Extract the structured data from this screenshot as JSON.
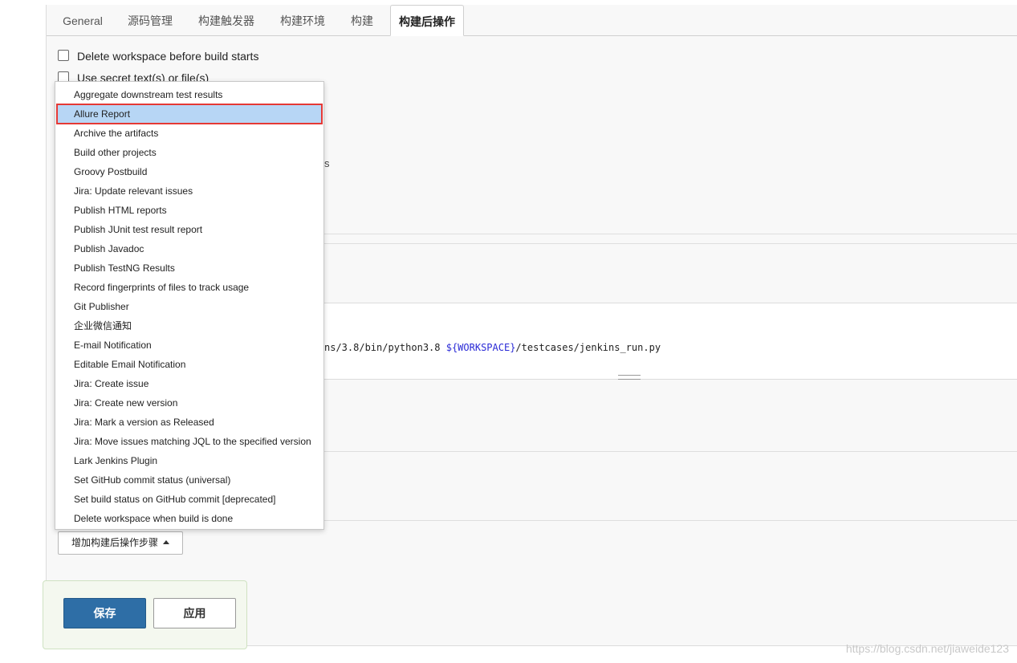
{
  "tabs": [
    {
      "label": "General",
      "active": false
    },
    {
      "label": "源码管理",
      "active": false
    },
    {
      "label": "构建触发器",
      "active": false
    },
    {
      "label": "构建环境",
      "active": false
    },
    {
      "label": "构建",
      "active": false
    },
    {
      "label": "构建后操作",
      "active": true
    }
  ],
  "build_env": {
    "options": [
      {
        "label": "Delete workspace before build starts",
        "checked": false
      },
      {
        "label": "Use secret text(s) or file(s)",
        "checked": false
      }
    ],
    "hidden_fragment": "s"
  },
  "build": {
    "command_prefix": "ns/3.8/bin/python3.8 ",
    "command_var": "${WORKSPACE}",
    "command_suffix": "/testcases/jenkins_run.py"
  },
  "post_build": {
    "menu_items": [
      {
        "label": "Aggregate downstream test results"
      },
      {
        "label": "Allure Report",
        "highlighted": true
      },
      {
        "label": "Archive the artifacts"
      },
      {
        "label": "Build other projects"
      },
      {
        "label": "Groovy Postbuild"
      },
      {
        "label": "Jira: Update relevant issues"
      },
      {
        "label": "Publish HTML reports"
      },
      {
        "label": "Publish JUnit test result report"
      },
      {
        "label": "Publish Javadoc"
      },
      {
        "label": "Publish TestNG Results"
      },
      {
        "label": "Record fingerprints of files to track usage"
      },
      {
        "label": "Git Publisher"
      },
      {
        "label": "企业微信通知"
      },
      {
        "label": "E-mail Notification"
      },
      {
        "label": "Editable Email Notification"
      },
      {
        "label": "Jira: Create issue"
      },
      {
        "label": "Jira: Create new version"
      },
      {
        "label": "Jira: Mark a version as Released"
      },
      {
        "label": "Jira: Move issues matching JQL to the specified version"
      },
      {
        "label": "Lark Jenkins Plugin"
      },
      {
        "label": "Set GitHub commit status (universal)"
      },
      {
        "label": "Set build status on GitHub commit [deprecated]"
      },
      {
        "label": "Delete workspace when build is done"
      }
    ],
    "add_step_label": "增加构建后操作步骤"
  },
  "actions": {
    "save_label": "保存",
    "apply_label": "应用"
  },
  "watermark": "https://blog.csdn.net/jiaweide123",
  "colors": {
    "save_button": "#2e6ea6",
    "highlight_fill": "#b7d6f5",
    "highlight_border": "#e53935",
    "variable_text": "#2b2bd6"
  }
}
